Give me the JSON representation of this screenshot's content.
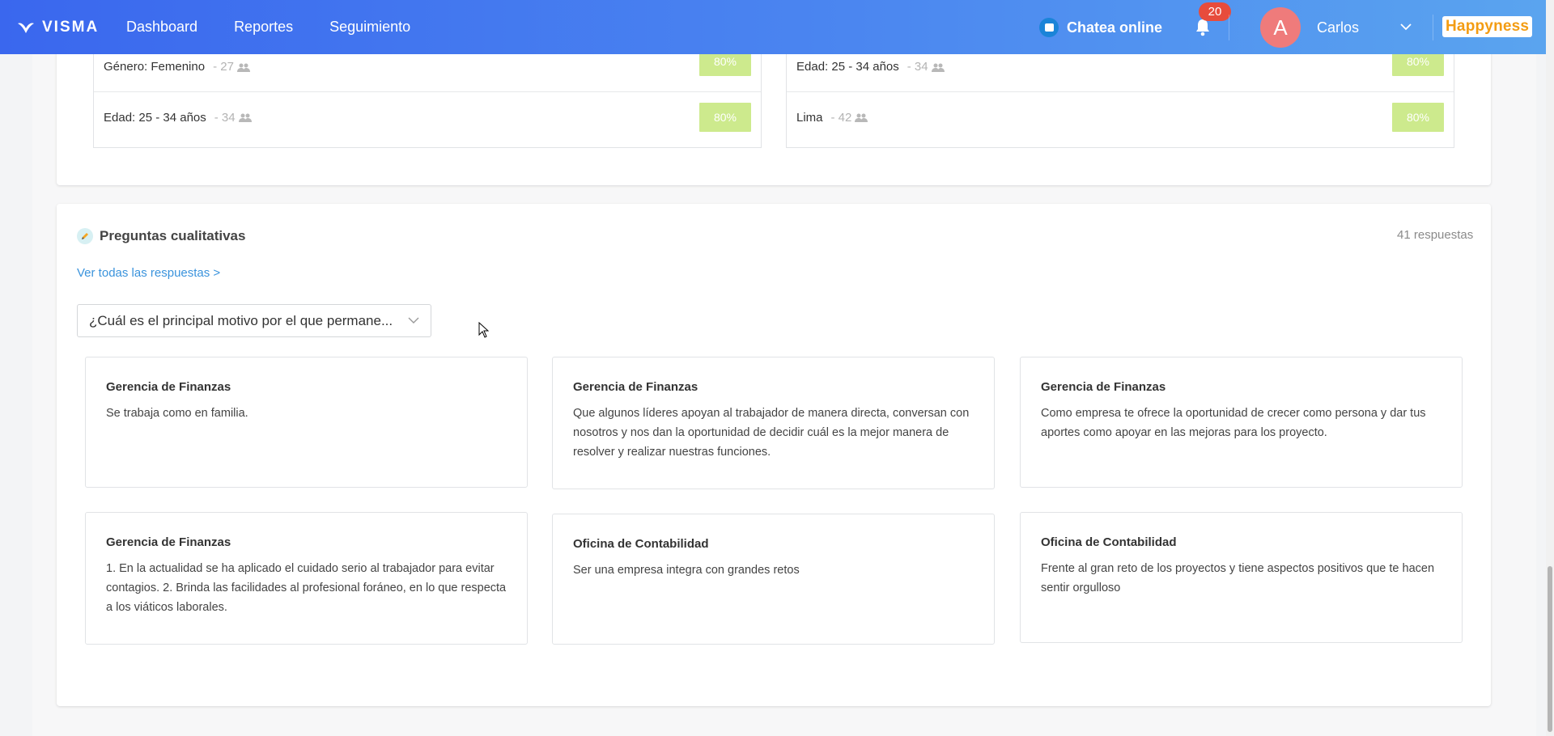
{
  "topbar": {
    "logo_text": "VISMA",
    "nav": [
      {
        "label": "Dashboard"
      },
      {
        "label": "Reportes"
      },
      {
        "label": "Seguimiento"
      }
    ],
    "chat_label": "Chatea online",
    "notifications_count": "20",
    "avatar_initial": "A",
    "user_name": "Carlos",
    "brand": "Happyness",
    "icons": {
      "logo": "visma-logo-icon",
      "chat": "chat-bubble-icon",
      "bell": "bell-icon",
      "user_menu": "chevron-down-icon"
    },
    "colors": {
      "gradient_start": "#3a67ee",
      "gradient_end": "#5aa4ef",
      "badge": "#e74c3c",
      "brand": "#f39c12"
    }
  },
  "segments": {
    "left": [
      {
        "label": "Género: Femenino",
        "count": "- 27",
        "percent": "80%"
      },
      {
        "label": "Edad: 25 - 34 años",
        "count": "- 34",
        "percent": "80%"
      }
    ],
    "right": [
      {
        "label": "Edad: 25 - 34 años",
        "count": "- 34",
        "percent": "80%"
      },
      {
        "label": "Lima",
        "count": "- 42",
        "percent": "80%"
      }
    ],
    "percent_color": "#cdea8d"
  },
  "qualitative": {
    "title": "Preguntas cualitativas",
    "responses_count": "41 respuestas",
    "view_all_link": "Ver todas las respuestas >",
    "question_select": "¿Cuál es el principal motivo por el que permane...",
    "responses": [
      {
        "department": "Gerencia de Finanzas",
        "text": "Se trabaja como en familia."
      },
      {
        "department": "Gerencia de Finanzas",
        "text": "Que algunos líderes apoyan al trabajador de manera directa, conversan con nosotros y nos dan la oportunidad de decidir cuál es la mejor manera de resolver y realizar nuestras funciones."
      },
      {
        "department": "Gerencia de Finanzas",
        "text": "Como empresa te ofrece la oportunidad de crecer como persona y dar tus aportes como apoyar en las mejoras para los proyecto."
      },
      {
        "department": "Gerencia de Finanzas",
        "text": "1. En la actualidad se ha aplicado el cuidado serio al trabajador para evitar contagios. 2. Brinda las facilidades al profesional foráneo, en lo que respecta a los viáticos laborales."
      },
      {
        "department": "Oficina de Contabilidad",
        "text": "Ser una empresa integra con grandes retos"
      },
      {
        "department": "Oficina de Contabilidad",
        "text": "Frente al gran reto de los proyectos y tiene aspectos positivos que te hacen sentir orgulloso"
      }
    ]
  }
}
